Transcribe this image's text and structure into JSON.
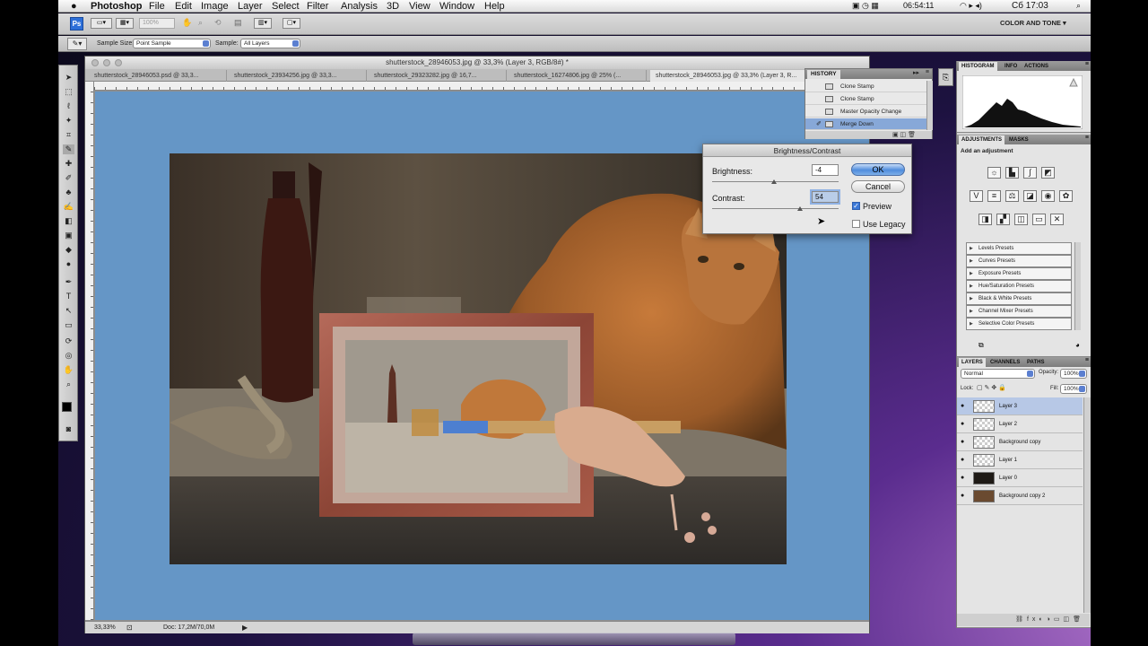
{
  "menubar": {
    "apple": "",
    "app_name": "Photoshop",
    "items": [
      "File",
      "Edit",
      "Image",
      "Layer",
      "Select",
      "Filter",
      "Analysis",
      "3D",
      "View",
      "Window",
      "Help"
    ],
    "clock": "06:54:11",
    "day_time": "Сб 17:03",
    "workspace": "COLOR AND TONE ▾"
  },
  "optbar": {
    "zoom_value": "100%"
  },
  "tool_options": {
    "sample_size_label": "Sample Size:",
    "sample_size_value": "Point Sample",
    "sample_label": "Sample:",
    "sample_value": "All Layers"
  },
  "document": {
    "title": "shutterstock_28946053.jpg @ 33,3% (Layer 3, RGB/8#) *",
    "tabs": [
      "shutterstock_28946053.psd @ 33,3...",
      "shutterstock_23934256.jpg @ 33,3...",
      "shutterstock_29323282.jpg @ 16,7...",
      "shutterstock_16274806.jpg @ 25% (...",
      "shutterstock_28946053.jpg @ 33,3% (Layer 3, R..."
    ],
    "status_zoom": "33,33%",
    "status_doc": "Doc: 17,2M/70,0M"
  },
  "history": {
    "tab": "HISTORY",
    "items": [
      "Clone Stamp",
      "Clone Stamp",
      "Master Opacity Change",
      "Merge Down"
    ],
    "selected_index": 3
  },
  "dialog": {
    "title": "Brightness/Contrast",
    "brightness_label": "Brightness:",
    "brightness_value": "-4",
    "contrast_label": "Contrast:",
    "contrast_value": "54",
    "ok_label": "OK",
    "cancel_label": "Cancel",
    "preview_label": "Preview",
    "preview_checked": true,
    "legacy_label": "Use Legacy",
    "legacy_checked": false
  },
  "histogram_panel": {
    "tabs": [
      "HISTOGRAM",
      "INFO",
      "ACTIONS"
    ]
  },
  "adjustments_panel": {
    "tabs": [
      "ADJUSTMENTS",
      "MASKS"
    ],
    "hint": "Add an adjustment",
    "presets": [
      "Levels Presets",
      "Curves Presets",
      "Exposure Presets",
      "Hue/Saturation Presets",
      "Black & White Presets",
      "Channel Mixer Presets",
      "Selective Color Presets"
    ]
  },
  "layers_panel": {
    "tabs": [
      "LAYERS",
      "CHANNELS",
      "PATHS"
    ],
    "blend_mode": "Normal",
    "opacity_label": "Opacity:",
    "opacity_value": "100%",
    "lock_label": "Lock:",
    "fill_label": "Fill:",
    "fill_value": "100%",
    "layers": [
      "Layer 3",
      "Layer 2",
      "Background copy",
      "Layer 1",
      "Layer 0",
      "Background copy 2"
    ],
    "selected_index": 0
  },
  "colors": {
    "canvas_bg": "#6596c6",
    "selection": "#87a8d8",
    "accent": "#4f8ddd"
  }
}
